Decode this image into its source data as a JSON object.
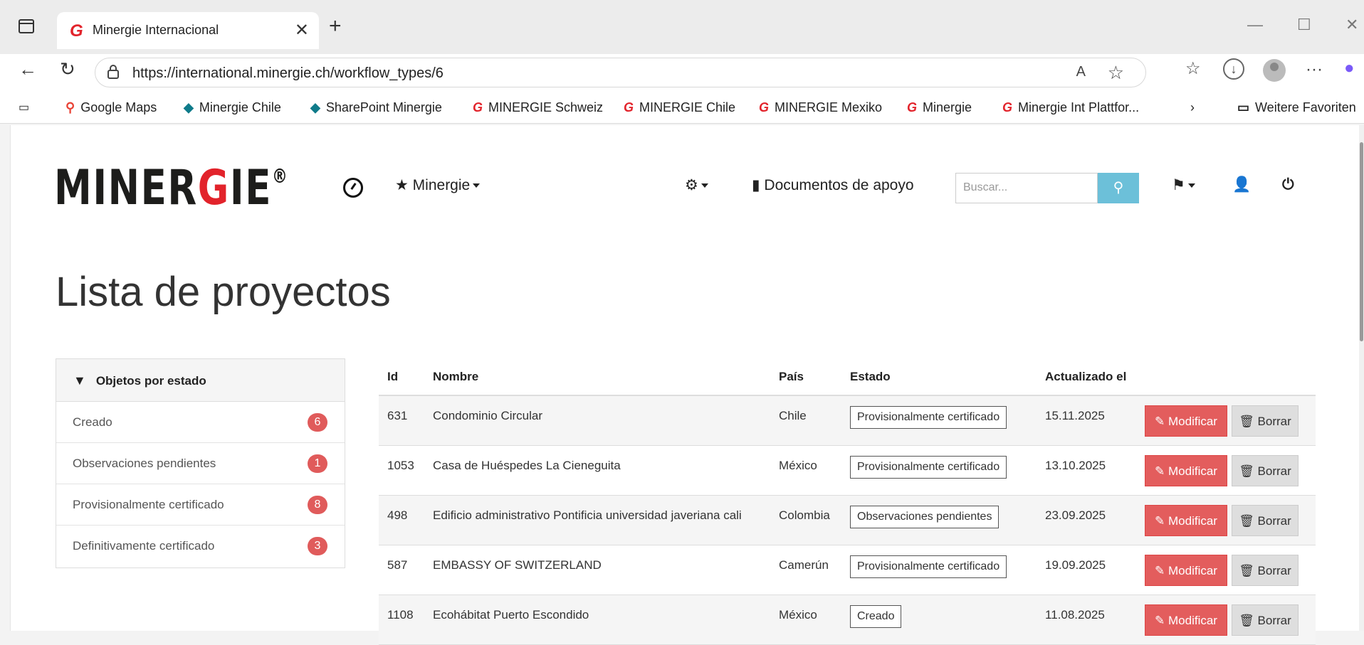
{
  "browser": {
    "tab_title": "Minergie Internacional",
    "url": "https://international.minergie.ch/workflow_types/6",
    "favorites": [
      {
        "icon": "map-pin-icon",
        "label": "Google Maps"
      },
      {
        "icon": "sharepoint-icon",
        "label": "Minergie Chile"
      },
      {
        "icon": "sharepoint-icon",
        "label": "SharePoint Minergie"
      },
      {
        "icon": "minergie-icon",
        "label": "MINERGIE Schweiz"
      },
      {
        "icon": "minergie-icon",
        "label": "MINERGIE Chile"
      },
      {
        "icon": "minergie-icon",
        "label": "MINERGIE Mexiko"
      },
      {
        "icon": "minergie-icon",
        "label": "Minergie"
      },
      {
        "icon": "minergie-icon",
        "label": "Minergie Int Plattfor..."
      }
    ],
    "more_favorites": "Weitere Favoriten"
  },
  "header": {
    "logo_text": "MINERGIE",
    "menu_minergie": "Minergie",
    "documents_label": "Documentos de apoyo",
    "search_placeholder": "Buscar..."
  },
  "page_title": "Lista de proyectos",
  "filter_panel": {
    "heading": "Objetos por estado",
    "items": [
      {
        "label": "Creado",
        "count": "6"
      },
      {
        "label": "Observaciones pendientes",
        "count": "1"
      },
      {
        "label": "Provisionalmente certificado",
        "count": "8"
      },
      {
        "label": "Definitivamente certificado",
        "count": "3"
      }
    ]
  },
  "table": {
    "columns": [
      "Id",
      "Nombre",
      "País",
      "Estado",
      "Actualizado el"
    ],
    "rows": [
      {
        "id": "631",
        "name": "Condominio Circular",
        "country": "Chile",
        "state": "Provisionalmente certificado",
        "updated": "15.11.2025"
      },
      {
        "id": "1053",
        "name": "Casa de Huéspedes La Cieneguita",
        "country": "México",
        "state": "Provisionalmente certificado",
        "updated": "13.10.2025"
      },
      {
        "id": "498",
        "name": "Edificio administrativo Pontificia universidad javeriana cali",
        "country": "Colombia",
        "state": "Observaciones pendientes",
        "updated": "23.09.2025"
      },
      {
        "id": "587",
        "name": "EMBASSY OF SWITZERLAND",
        "country": "Camerún",
        "state": "Provisionalmente certificado",
        "updated": "19.09.2025"
      },
      {
        "id": "1108",
        "name": "Ecohábitat Puerto Escondido",
        "country": "México",
        "state": "Creado",
        "updated": "11.08.2025"
      }
    ],
    "edit_label": "Modificar",
    "delete_label": "Borrar"
  }
}
